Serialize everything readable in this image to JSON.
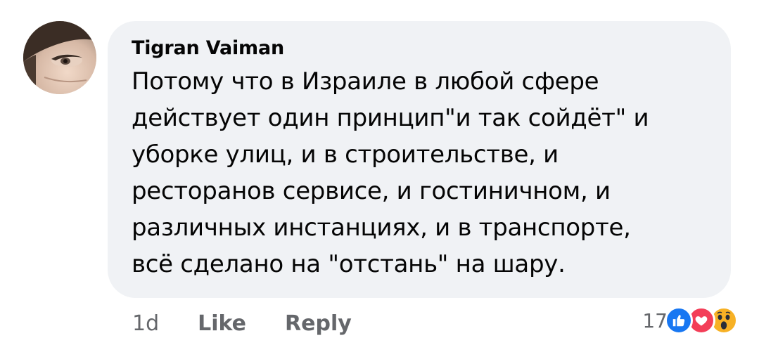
{
  "comment": {
    "author": "Tigran Vaiman",
    "text_lines": [
      "Потому что в Израиле в любой сфере",
      "действует один принцип\"и так сойдёт\" и",
      "уборке улиц, и в строительстве, и",
      "ресторанов сервисе, и гостиничном, и",
      "различных инстанциях, и в транспорте,",
      "всё сделано на \"отстань\" на шару."
    ],
    "avatar_icon": "profile-photo"
  },
  "actions": {
    "timestamp": "1d",
    "like_label": "Like",
    "reply_label": "Reply"
  },
  "reactions": {
    "count": "17",
    "icons": [
      "like-icon",
      "love-icon",
      "wow-icon"
    ],
    "colors": {
      "like": "#1877f2",
      "love": "#f33e58",
      "wow": "#f7b125"
    }
  },
  "colors": {
    "bubble": "#f0f2f5",
    "text": "#050505",
    "secondary": "#65676b"
  }
}
